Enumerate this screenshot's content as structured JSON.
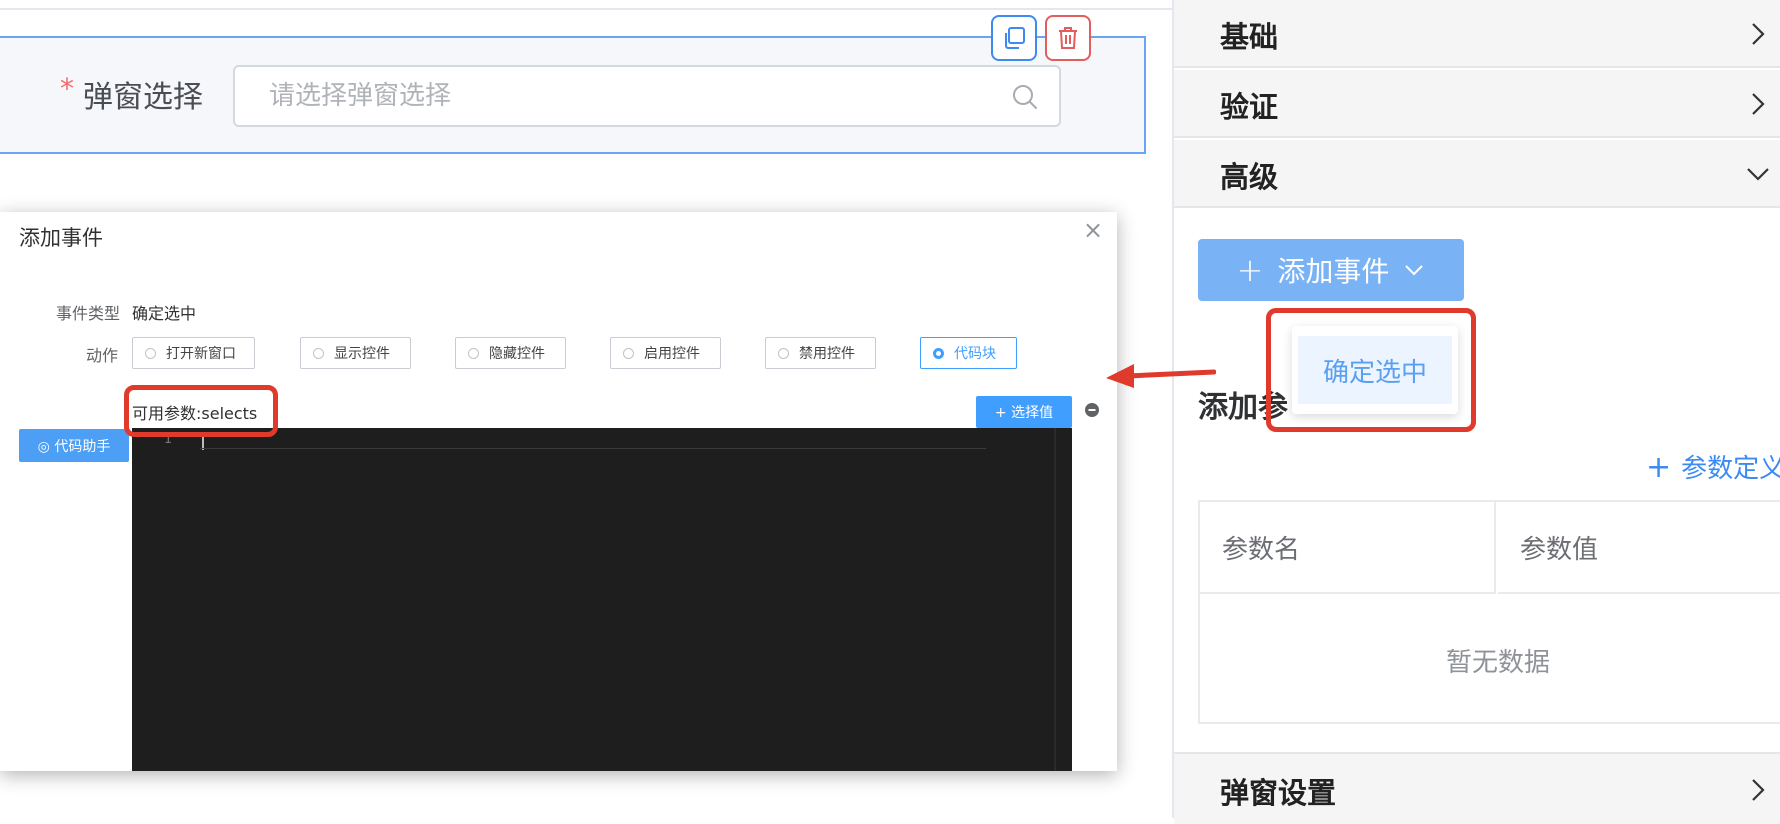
{
  "field": {
    "required_mark": "*",
    "label": "弹窗选择",
    "placeholder": "请选择弹窗选择"
  },
  "right_panel": {
    "sections": [
      "基础",
      "验证",
      "高级"
    ],
    "add_event_button": "添加事件",
    "dropdown_items": [
      "确定选中"
    ],
    "add_params_title": "添加参",
    "param_define_link": "参数定义",
    "table": {
      "columns": [
        "参数名",
        "参数值"
      ],
      "empty_text": "暂无数据"
    },
    "popup_settings": "弹窗设置"
  },
  "dialog": {
    "title": "添加事件",
    "close": "×",
    "event_type_label": "事件类型",
    "event_type_value": "确定选中",
    "action_label": "动作",
    "actions": [
      "打开新窗口",
      "显示控件",
      "隐藏控件",
      "启用控件",
      "禁用控件",
      "代码块"
    ],
    "selected_action": "代码块",
    "params_text": "可用参数:selects",
    "select_value_button": "+ 选择值",
    "code_helper_button": "◎ 代码助手",
    "line_number": "1"
  },
  "colors": {
    "primary": "#409eff",
    "danger": "#e35d5d",
    "highlight": "#e03a2c",
    "editor_bg": "#1e1e1e"
  }
}
